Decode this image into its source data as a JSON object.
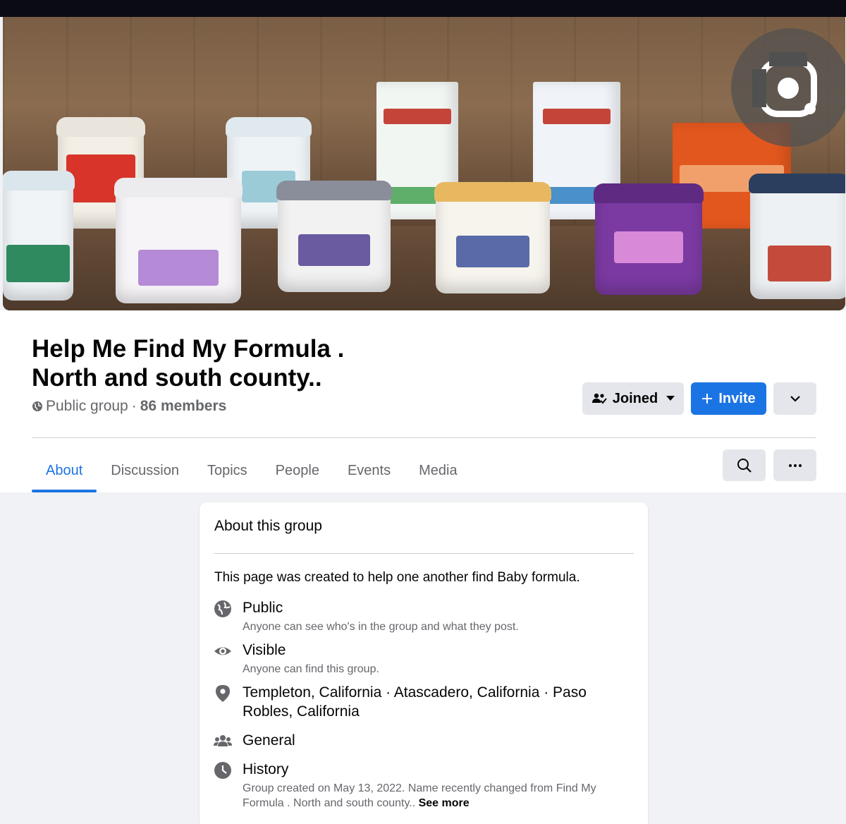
{
  "group": {
    "title_line1": "Help Me Find My Formula .",
    "title_line2": "North and south county..",
    "privacy": "Public group",
    "separator": "·",
    "members": "86 members"
  },
  "actions": {
    "joined_label": "Joined",
    "invite_label": "Invite"
  },
  "tabs": [
    {
      "label": "About",
      "active": true
    },
    {
      "label": "Discussion"
    },
    {
      "label": "Topics"
    },
    {
      "label": "People"
    },
    {
      "label": "Events"
    },
    {
      "label": "Media"
    }
  ],
  "about": {
    "heading": "About this group",
    "description": "This page was created to help one another find Baby formula.",
    "items": [
      {
        "icon": "globe-icon",
        "title": "Public",
        "subtitle": "Anyone can see who's in the group and what they post."
      },
      {
        "icon": "eye-icon",
        "title": "Visible",
        "subtitle": "Anyone can find this group."
      },
      {
        "icon": "location-pin-icon",
        "title": "Templeton, California · Atascadero, California · Paso Robles, California"
      },
      {
        "icon": "people-icon",
        "title": "General"
      },
      {
        "icon": "clock-icon",
        "title": "History",
        "subtitle": "Group created on May 13, 2022. Name recently changed from Find My Formula . North and south county..",
        "see_more": "See more"
      }
    ]
  },
  "colors": {
    "accent": "#1b74e4",
    "background": "#f0f2f5",
    "secondary_text": "#65676b"
  }
}
